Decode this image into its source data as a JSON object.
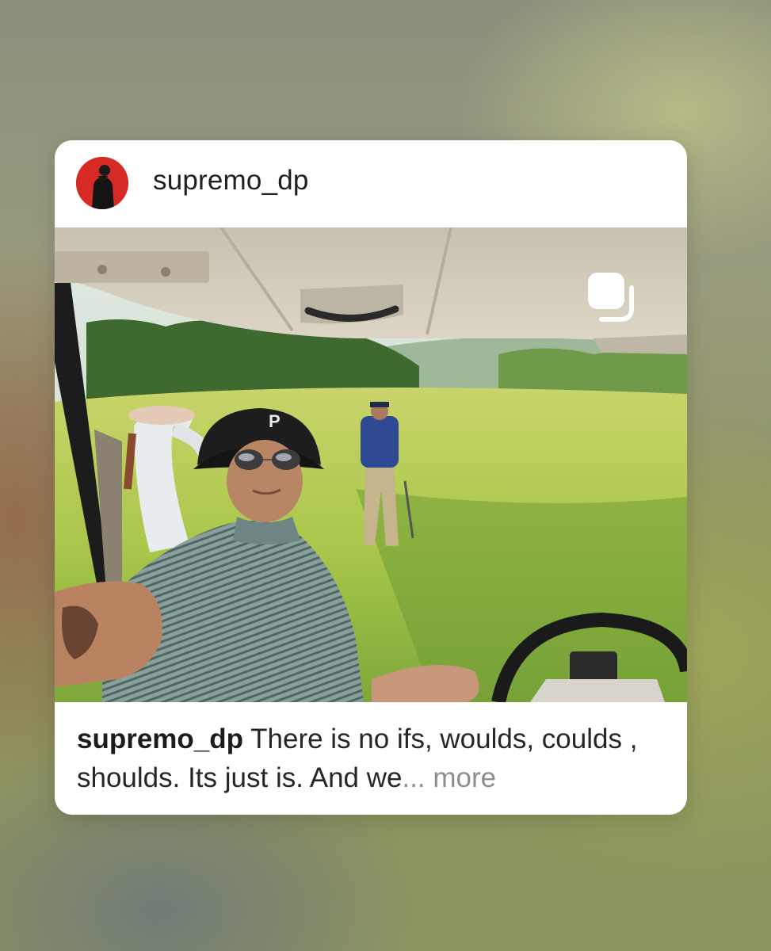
{
  "post": {
    "username": "supremo_dp",
    "image_alt": "Selfie in a golf cart on a golf course",
    "multi_image_icon": "carousel-icon",
    "caption": {
      "username": "supremo_dp",
      "text": "There is no ifs, woulds, coulds , shoulds. Its just is. And we",
      "ellipsis": "...",
      "more_label": "more"
    }
  },
  "colors": {
    "card_bg": "#ffffff",
    "avatar_bg": "#d62b25",
    "text": "#262626",
    "more": "#8e8e8e"
  }
}
